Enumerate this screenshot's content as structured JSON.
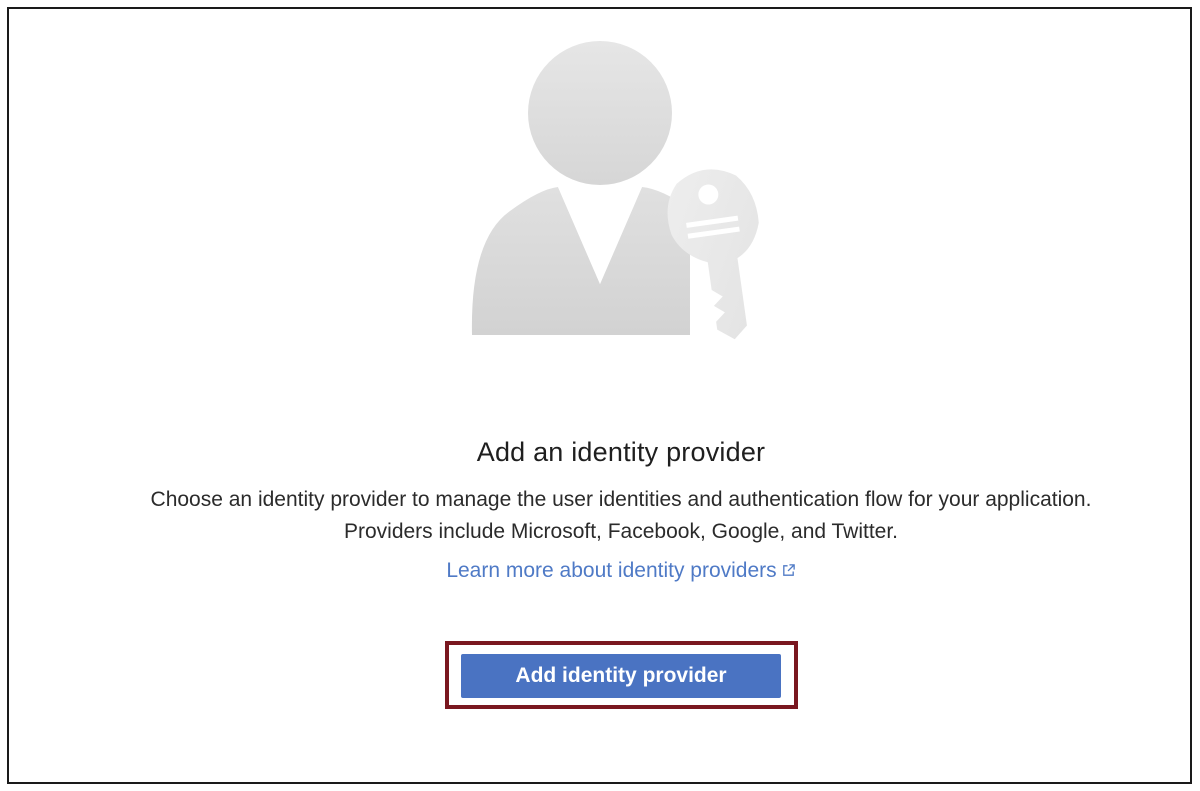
{
  "empty_state": {
    "illustration_icon": "user-with-key-icon",
    "heading": "Add an identity provider",
    "description_line_1": "Choose an identity provider to manage the user identities and authentication flow for your application.",
    "description_line_2": "Providers include Microsoft, Facebook, Google, and Twitter.",
    "learn_more_link": "Learn more about identity providers",
    "learn_more_icon": "external-link-icon",
    "primary_button_label": "Add identity provider"
  },
  "colors": {
    "link": "#4f7ac6",
    "button": "#4a73c2",
    "highlight_border": "#7a1720",
    "illustration_gray": "#e3e3e3"
  }
}
